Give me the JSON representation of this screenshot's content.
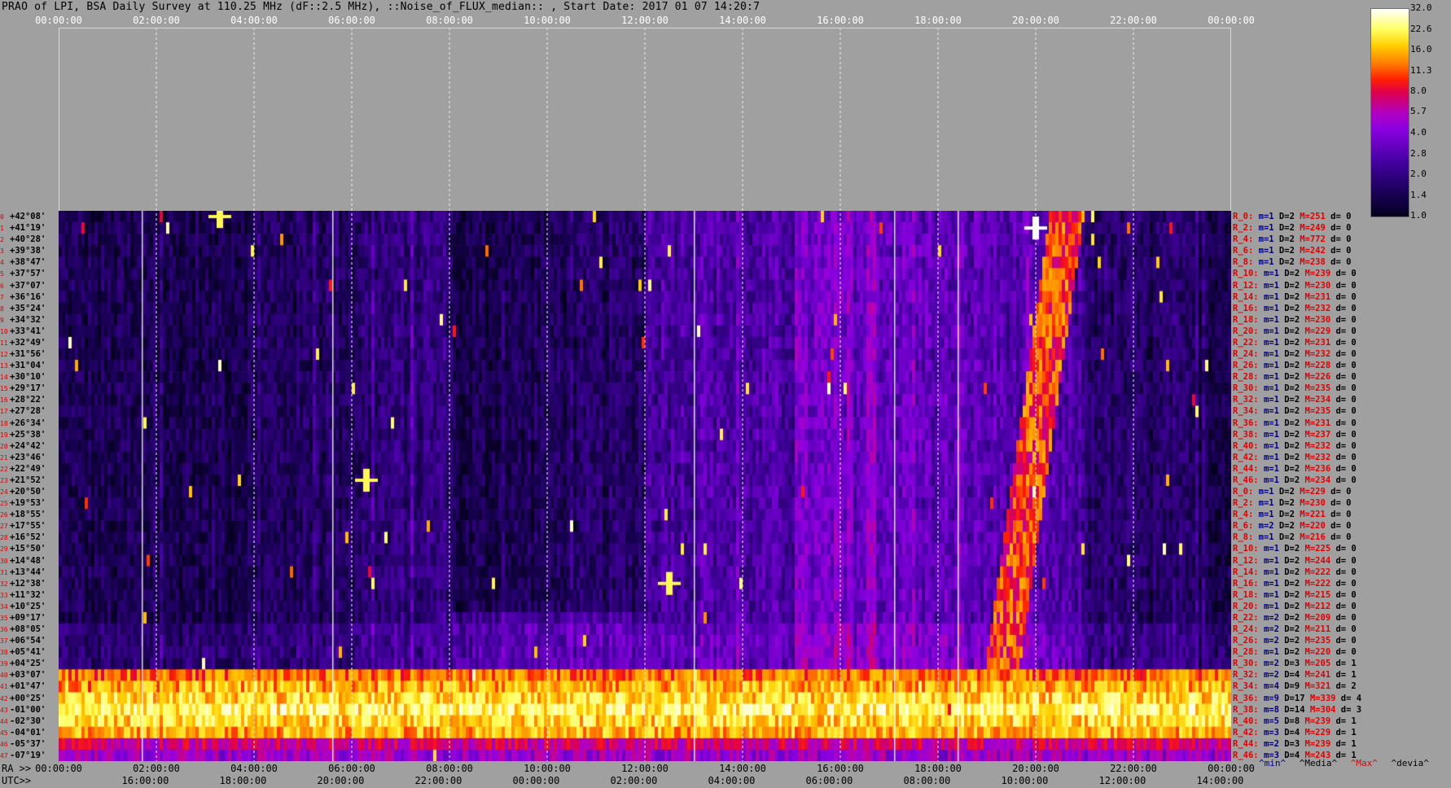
{
  "title": "PRAO of LPI, BSA Daily Survey at 110.25 MHz (dF::2.5 MHz), ::Noise_of_FLUX_median:: , Start Date: 2017 01 07 14:20:7",
  "top_ticks": [
    "00:00:00",
    "02:00:00",
    "04:00:00",
    "06:00:00",
    "08:00:00",
    "10:00:00",
    "12:00:00",
    "14:00:00",
    "16:00:00",
    "18:00:00",
    "20:00:00",
    "22:00:00",
    "00:00:00"
  ],
  "ra_prefix": "RA >>",
  "utc_prefix": "UTC>>",
  "ra_ticks": [
    "00:00:00",
    "02:00:00",
    "04:00:00",
    "06:00:00",
    "08:00:00",
    "10:00:00",
    "12:00:00",
    "14:00:00",
    "16:00:00",
    "18:00:00",
    "20:00:00",
    "22:00:00",
    "00:00:00"
  ],
  "utc_ticks": [
    "16:00:00",
    "18:00:00",
    "20:00:00",
    "22:00:00",
    "00:00:00",
    "02:00:00",
    "04:00:00",
    "06:00:00",
    "08:00:00",
    "10:00:00",
    "12:00:00",
    "14:00:00"
  ],
  "colorbar": {
    "ticks": [
      "32.0",
      "22.6",
      "16.0",
      "11.3",
      "8.0",
      "5.7",
      "4.0",
      "2.8",
      "2.0",
      "1.4",
      "1.0"
    ]
  },
  "legend": {
    "min": "^min^",
    "median": "^Media^",
    "max": "^Max^",
    "dev": "^devia^"
  },
  "declinations": [
    "+42°08'",
    "+41°19'",
    "+40°28'",
    "+39°38'",
    "+38°47'",
    "+37°57'",
    "+37°07'",
    "+36°16'",
    "+35°24'",
    "+34°32'",
    "+33°41'",
    "+32°49'",
    "+31°56'",
    "+31°04'",
    "+30°10'",
    "+29°17'",
    "+28°22'",
    "+27°28'",
    "+26°34'",
    "+25°38'",
    "+24°42'",
    "+23°46'",
    "+22°49'",
    "+21°52'",
    "+20°50'",
    "+19°53'",
    "+18°55'",
    "+17°55'",
    "+16°52'",
    "+15°50'",
    "+14°48'",
    "+13°44'",
    "+12°38'",
    "+11°32'",
    "+10°25'",
    "+09°17'",
    "+08°05'",
    "+06°54'",
    "+05°41'",
    "+04°25'",
    "+03°07'",
    "+01°47'",
    "+00°25'",
    "-01°00'",
    "-02°30'",
    "-04°01'",
    "-05°37'",
    "-07°19'"
  ],
  "stats": [
    {
      "r": "R_0:",
      "m": "m=1",
      "d": "D=2",
      "mx": "M=251",
      "dv": "d= 0"
    },
    {
      "r": "R_2:",
      "m": "m=1",
      "d": "D=2",
      "mx": "M=249",
      "dv": "d= 0"
    },
    {
      "r": "R_4:",
      "m": "m=1",
      "d": "D=2",
      "mx": "M=772",
      "dv": "d= 0"
    },
    {
      "r": "R_6:",
      "m": "m=1",
      "d": "D=2",
      "mx": "M=242",
      "dv": "d= 0"
    },
    {
      "r": "R_8:",
      "m": "m=1",
      "d": "D=2",
      "mx": "M=238",
      "dv": "d= 0"
    },
    {
      "r": "R_10:",
      "m": "m=1",
      "d": "D=2",
      "mx": "M=239",
      "dv": "d= 0"
    },
    {
      "r": "R_12:",
      "m": "m=1",
      "d": "D=2",
      "mx": "M=230",
      "dv": "d= 0"
    },
    {
      "r": "R_14:",
      "m": "m=1",
      "d": "D=2",
      "mx": "M=231",
      "dv": "d= 0"
    },
    {
      "r": "R_16:",
      "m": "m=1",
      "d": "D=2",
      "mx": "M=232",
      "dv": "d= 0"
    },
    {
      "r": "R_18:",
      "m": "m=1",
      "d": "D=2",
      "mx": "M=230",
      "dv": "d= 0"
    },
    {
      "r": "R_20:",
      "m": "m=1",
      "d": "D=2",
      "mx": "M=229",
      "dv": "d= 0"
    },
    {
      "r": "R_22:",
      "m": "m=1",
      "d": "D=2",
      "mx": "M=231",
      "dv": "d= 0"
    },
    {
      "r": "R_24:",
      "m": "m=1",
      "d": "D=2",
      "mx": "M=232",
      "dv": "d= 0"
    },
    {
      "r": "R_26:",
      "m": "m=1",
      "d": "D=2",
      "mx": "M=228",
      "dv": "d= 0"
    },
    {
      "r": "R_28:",
      "m": "m=1",
      "d": "D=2",
      "mx": "M=226",
      "dv": "d= 0"
    },
    {
      "r": "R_30:",
      "m": "m=1",
      "d": "D=2",
      "mx": "M=235",
      "dv": "d= 0"
    },
    {
      "r": "R_32:",
      "m": "m=1",
      "d": "D=2",
      "mx": "M=234",
      "dv": "d= 0"
    },
    {
      "r": "R_34:",
      "m": "m=1",
      "d": "D=2",
      "mx": "M=235",
      "dv": "d= 0"
    },
    {
      "r": "R_36:",
      "m": "m=1",
      "d": "D=2",
      "mx": "M=231",
      "dv": "d= 0"
    },
    {
      "r": "R_38:",
      "m": "m=1",
      "d": "D=2",
      "mx": "M=237",
      "dv": "d= 0"
    },
    {
      "r": "R_40:",
      "m": "m=1",
      "d": "D=2",
      "mx": "M=232",
      "dv": "d= 0"
    },
    {
      "r": "R_42:",
      "m": "m=1",
      "d": "D=2",
      "mx": "M=232",
      "dv": "d= 0"
    },
    {
      "r": "R_44:",
      "m": "m=1",
      "d": "D=2",
      "mx": "M=236",
      "dv": "d= 0"
    },
    {
      "r": "R_46:",
      "m": "m=1",
      "d": "D=2",
      "mx": "M=234",
      "dv": "d= 0"
    },
    {
      "r": "R_0:",
      "m": "m=1",
      "d": "D=2",
      "mx": "M=229",
      "dv": "d= 0"
    },
    {
      "r": "R_2:",
      "m": "m=1",
      "d": "D=2",
      "mx": "M=230",
      "dv": "d= 0"
    },
    {
      "r": "R_4:",
      "m": "m=1",
      "d": "D=2",
      "mx": "M=221",
      "dv": "d= 0"
    },
    {
      "r": "R_6:",
      "m": "m=2",
      "d": "D=2",
      "mx": "M=220",
      "dv": "d= 0"
    },
    {
      "r": "R_8:",
      "m": "m=1",
      "d": "D=2",
      "mx": "M=216",
      "dv": "d= 0"
    },
    {
      "r": "R_10:",
      "m": "m=1",
      "d": "D=2",
      "mx": "M=225",
      "dv": "d= 0"
    },
    {
      "r": "R_12:",
      "m": "m=1",
      "d": "D=2",
      "mx": "M=244",
      "dv": "d= 0"
    },
    {
      "r": "R_14:",
      "m": "m=1",
      "d": "D=2",
      "mx": "M=222",
      "dv": "d= 0"
    },
    {
      "r": "R_16:",
      "m": "m=1",
      "d": "D=2",
      "mx": "M=222",
      "dv": "d= 0"
    },
    {
      "r": "R_18:",
      "m": "m=1",
      "d": "D=2",
      "mx": "M=215",
      "dv": "d= 0"
    },
    {
      "r": "R_20:",
      "m": "m=1",
      "d": "D=2",
      "mx": "M=212",
      "dv": "d= 0"
    },
    {
      "r": "R_22:",
      "m": "m=2",
      "d": "D=2",
      "mx": "M=209",
      "dv": "d= 0"
    },
    {
      "r": "R_24:",
      "m": "m=2",
      "d": "D=2",
      "mx": "M=211",
      "dv": "d= 0"
    },
    {
      "r": "R_26:",
      "m": "m=2",
      "d": "D=2",
      "mx": "M=235",
      "dv": "d= 0"
    },
    {
      "r": "R_28:",
      "m": "m=1",
      "d": "D=2",
      "mx": "M=220",
      "dv": "d= 0"
    },
    {
      "r": "R_30:",
      "m": "m=2",
      "d": "D=3",
      "mx": "M=205",
      "dv": "d= 1"
    },
    {
      "r": "R_32:",
      "m": "m=2",
      "d": "D=4",
      "mx": "M=241",
      "dv": "d= 1"
    },
    {
      "r": "R_34:",
      "m": "m=4",
      "d": "D=9",
      "mx": "M=321",
      "dv": "d= 2"
    },
    {
      "r": "R_36:",
      "m": "m=9",
      "d": "D=17",
      "mx": "M=339",
      "dv": "d= 4"
    },
    {
      "r": "R_38:",
      "m": "m=8",
      "d": "D=14",
      "mx": "M=304",
      "dv": "d= 3"
    },
    {
      "r": "R_40:",
      "m": "m=5",
      "d": "D=8",
      "mx": "M=239",
      "dv": "d= 1"
    },
    {
      "r": "R_42:",
      "m": "m=3",
      "d": "D=4",
      "mx": "M=229",
      "dv": "d= 1"
    },
    {
      "r": "R_44:",
      "m": "m=2",
      "d": "D=3",
      "mx": "M=239",
      "dv": "d= 1"
    },
    {
      "r": "R_46:",
      "m": "m=3",
      "d": "D=4",
      "mx": "M=243",
      "dv": "d= 1"
    }
  ],
  "chart_data": {
    "type": "heatmap",
    "title": "PRAO of LPI, BSA Daily Survey at 110.25 MHz (dF::2.5 MHz), ::Noise_of_FLUX_median:: , Start Date: 2017 01 07 14:20:7",
    "x_range_hours": [
      0,
      24
    ],
    "rows": 48,
    "color_scale": "log",
    "vmin": 1.0,
    "vmax": 32.0,
    "noisy_band_rows": [
      40,
      47
    ],
    "bright_sources": [
      {
        "ra_hours": 20.0,
        "row": 1,
        "value": 32.0
      },
      {
        "ra_hours": 3.3,
        "row": 0,
        "value": 22.0
      },
      {
        "ra_hours": 6.3,
        "row": 23,
        "value": 22.0
      },
      {
        "ra_hours": 12.5,
        "row": 32,
        "value": 22.0
      }
    ],
    "colors": {
      "low": "#05001e",
      "mid": "#8a00e0",
      "high": "#ff2000",
      "peak": "#ffffff"
    }
  }
}
